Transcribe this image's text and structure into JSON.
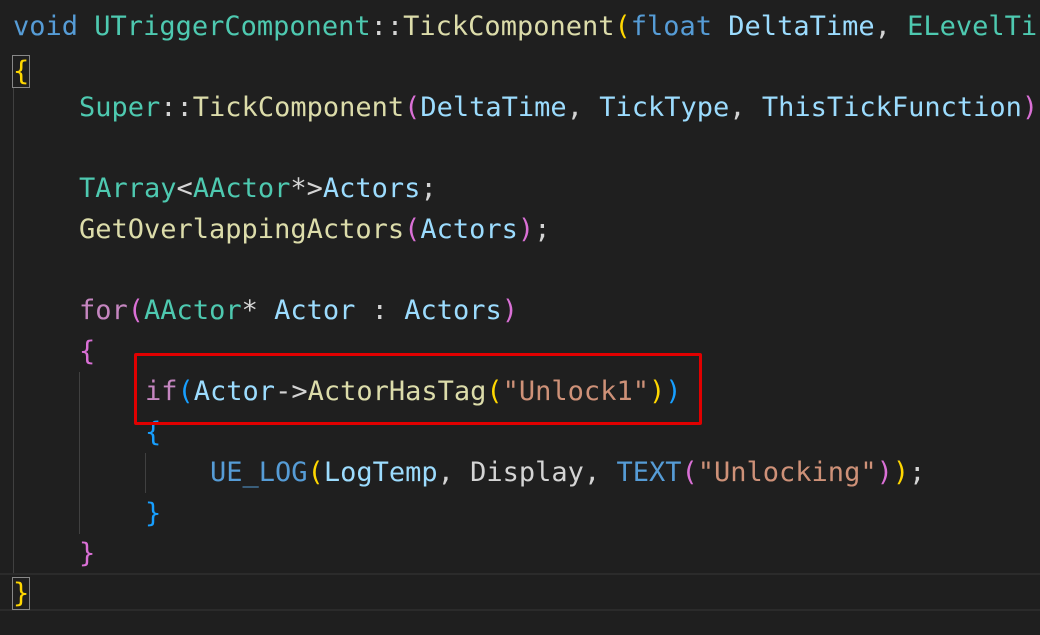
{
  "code": {
    "l1": {
      "void": "void",
      "cls": "UTriggerComponent",
      "sep": "::",
      "fn": "TickComponent",
      "open": "(",
      "float": "float",
      "param": "DeltaTime",
      "comma": ",",
      "type": "ELevelTi"
    },
    "l2": {
      "brace": "{"
    },
    "l3": {
      "super": "Super",
      "sep": "::",
      "fn": "TickComponent",
      "open": "(",
      "a1": "DeltaTime",
      "c1": ",",
      "a2": "TickType",
      "c2": ",",
      "a3": "ThisTickFunction",
      "close": ")"
    },
    "l5": {
      "type": "TArray",
      "lt": "<",
      "inner": "AActor",
      "star": "*",
      "gt": ">",
      "var": "Actors",
      "semi": ";"
    },
    "l6": {
      "fn": "GetOverlappingActors",
      "open": "(",
      "arg": "Actors",
      "close": ")",
      "semi": ";"
    },
    "l8": {
      "kw": "for",
      "open": "(",
      "type": "AActor",
      "star": "*",
      "var": "Actor",
      "colon": ":",
      "range": "Actors",
      "close": ")"
    },
    "l9": {
      "brace": "{"
    },
    "l10": {
      "kw": "if",
      "open": "(",
      "obj": "Actor",
      "arrow": "->",
      "fn": "ActorHasTag",
      "open2": "(",
      "str": "\"Unlock1\"",
      "close2": ")",
      "close": ")"
    },
    "l11": {
      "brace": "{"
    },
    "l12": {
      "macro": "UE_LOG",
      "open": "(",
      "a1": "LogTemp",
      "c1": ",",
      "a2": "Display",
      "c2": ",",
      "text": "TEXT",
      "open2": "(",
      "str": "\"Unlocking\"",
      "close2": ")",
      "close": ")",
      "semi": ";"
    },
    "l13": {
      "brace": "}"
    },
    "l14": {
      "brace": "}"
    },
    "l15": {
      "brace": "}"
    }
  },
  "colors": {
    "background": "#1f1f1f",
    "keyword": "#569cd6",
    "control": "#c586c0",
    "type": "#4ec9b0",
    "function": "#dcdcaa",
    "variable": "#9cdcfe",
    "string": "#ce9178",
    "bracket_gold": "#ffd700",
    "bracket_orchid": "#da70d6",
    "bracket_blue": "#179fff",
    "highlight_box": "#e00000"
  }
}
